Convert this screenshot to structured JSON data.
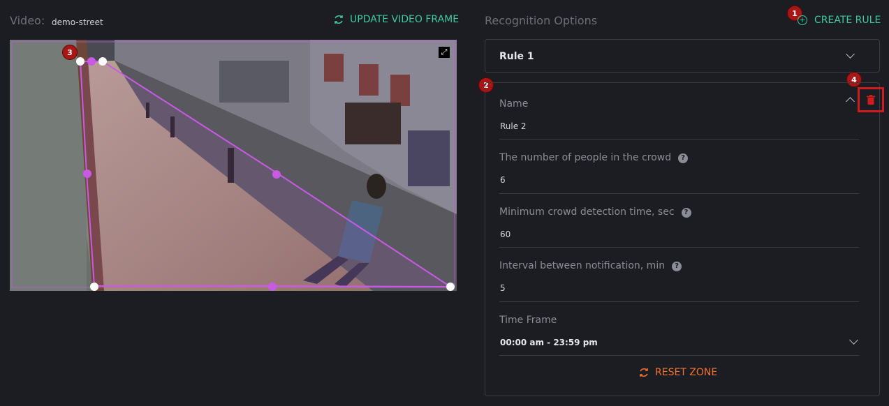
{
  "video": {
    "label": "Video:",
    "name": "demo-street",
    "update_label": "UPDATE VIDEO FRAME"
  },
  "recognition": {
    "title": "Recognition Options",
    "create_label": "CREATE RULE"
  },
  "rules": [
    {
      "title": "Rule 1"
    },
    {
      "fields": {
        "name": {
          "label": "Name",
          "value": "Rule 2"
        },
        "people": {
          "label": "The number of people in the crowd",
          "value": "6"
        },
        "min_time": {
          "label": "Minimum crowd detection time, sec",
          "value": "60"
        },
        "interval": {
          "label": "Interval between notification, min",
          "value": "5"
        },
        "time_frame": {
          "label": "Time Frame",
          "value": "00:00 am - 23:59 pm"
        }
      },
      "reset_label": "RESET ZONE"
    }
  ],
  "markers": [
    "1",
    "2",
    "3",
    "4"
  ],
  "colors": {
    "accent": "#3fc9a0",
    "danger": "#d01c1c",
    "reset": "#f0722e",
    "zone": "#c85ae6"
  },
  "icons": [
    "refresh-icon",
    "plus-circle-icon",
    "chevron-down-icon",
    "chevron-up-icon",
    "help-icon",
    "trash-icon",
    "expand-icon"
  ]
}
